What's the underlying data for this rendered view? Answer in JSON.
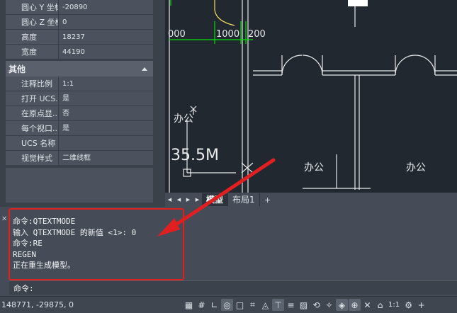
{
  "properties": {
    "rows_top": [
      {
        "key": "圆心 Y 坐标",
        "value": "-20890"
      },
      {
        "key": "圆心 Z 坐标",
        "value": "0"
      },
      {
        "key": "高度",
        "value": "18237"
      },
      {
        "key": "宽度",
        "value": "44190"
      }
    ],
    "section_other": "其他",
    "rows_other": [
      {
        "key": "注释比例",
        "value": "1:1"
      },
      {
        "key": "打开 UCS...",
        "value": "是"
      },
      {
        "key": "在原点显...",
        "value": "否"
      },
      {
        "key": "每个视口...",
        "value": "是"
      },
      {
        "key": "UCS 名称",
        "value": ""
      },
      {
        "key": "视觉样式",
        "value": "二维线框"
      }
    ]
  },
  "drawing": {
    "dims": [
      "000",
      "1000",
      "200"
    ],
    "room_left": "办公",
    "room_mid": "办公",
    "room_right": "办公",
    "big_text": "35.5M"
  },
  "tabs": {
    "model": "模型",
    "layout1": "布局1",
    "add": "+"
  },
  "command": {
    "history": [
      "命令:QTEXTMODE",
      "输入 QTEXTMODE 的新值 <1>: 0",
      "命令:RE",
      "REGEN",
      "正在重生成模型。"
    ],
    "prompt": "命令:"
  },
  "status": {
    "coords": "148771, -29875, 0",
    "scale": "1:1"
  },
  "colors": {
    "highlight": "#e02020",
    "canvas": "#212830",
    "dimension": "#00e000"
  }
}
